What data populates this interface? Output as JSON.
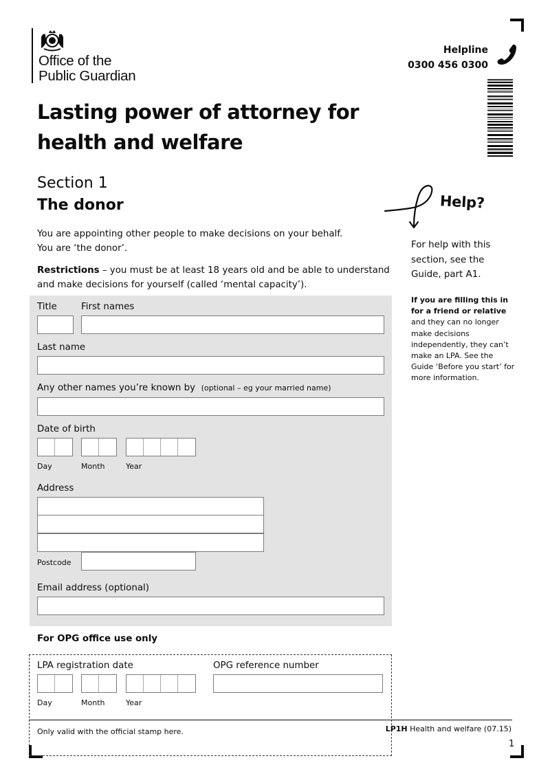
{
  "header": {
    "org_name_line1": "Office of the",
    "org_name_line2": "Public Guardian",
    "helpline_label": "Helpline",
    "helpline_number": "0300 456 0300"
  },
  "document": {
    "title_line1": "Lasting power of attorney for",
    "title_line2": "health and welfare",
    "section_number": "Section 1",
    "section_name": "The donor",
    "intro_line1": "You are appointing other people to make decisions on your behalf.",
    "intro_line2": "You are ‘the donor’.",
    "restrictions_label": "Restrictions",
    "restrictions_text": " – you must be at least 18 years old and be able to understand and make decisions for yourself (called ‘mental capacity’)."
  },
  "help": {
    "title": "Help?",
    "text": "For help with this section, see the Guide, part A1.",
    "note_bold": "If you are filling this in for a friend or relative",
    "note_text": " and they can no longer make decisions independently, they can’t make an LPA. See the Guide ‘Before you start’ for more information."
  },
  "form": {
    "title_label": "Title",
    "title_value": "",
    "first_names_label": "First names",
    "first_names_value": "",
    "last_name_label": "Last name",
    "last_name_value": "",
    "other_names_label": "Any other names you’re known by",
    "other_names_hint": "(optional – eg your married name)",
    "other_names_value": "",
    "dob_label": "Date of birth",
    "day_label": "Day",
    "month_label": "Month",
    "year_label": "Year",
    "address_label": "Address",
    "postcode_label": "Postcode",
    "email_label": "Email address (optional)"
  },
  "office": {
    "heading": "For OPG office use only",
    "registration_date_label": "LPA registration date",
    "reference_label": "OPG reference number",
    "day_label": "Day",
    "month_label": "Month",
    "year_label": "Year",
    "stamp_text": "Only valid with the official stamp here."
  },
  "footer": {
    "form_code": "LP1H",
    "form_name": " Health and welfare (07.15)",
    "page_number": "1"
  }
}
